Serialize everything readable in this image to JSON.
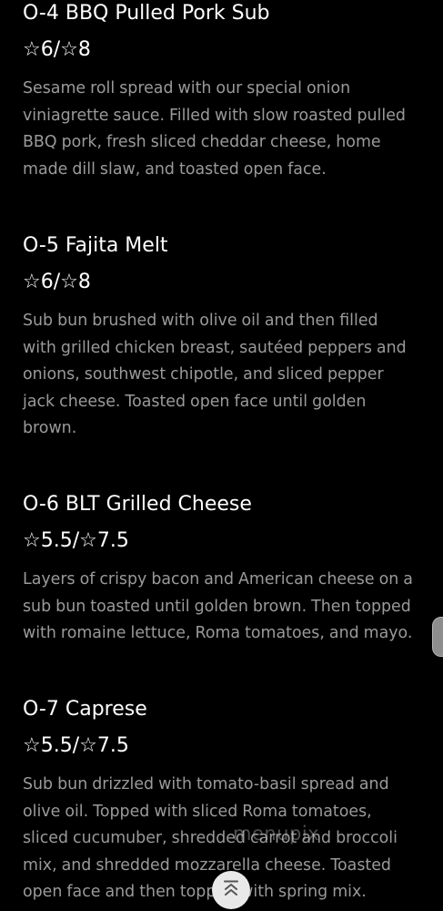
{
  "menu": {
    "items": [
      {
        "title": "O-4 BBQ Pulled Pork Sub",
        "price": "☆6/☆8",
        "description_lines": [
          "Sesame roll spread with our special onion",
          "viniagrette sauce. Filled with slow roasted pulled",
          "BBQ pork, fresh sliced cheddar cheese, home",
          "made dill slaw, and toasted open face."
        ]
      },
      {
        "title": "O-5 Fajita Melt",
        "price": "☆6/☆8",
        "description_lines": [
          "Sub bun brushed with olive oil and then filled",
          "with grilled chicken breast, sautéed peppers and",
          "onions, southwest chipotle, and sliced pepper",
          "jack cheese. Toasted open face until golden",
          "brown."
        ]
      },
      {
        "title": "O-6 BLT Grilled Cheese",
        "price": "☆5.5/☆7.5",
        "description_lines": [
          "Layers of crispy bacon and American cheese on a",
          "sub bun toasted until golden brown. Then topped",
          "with romaine lettuce, Roma tomatoes, and mayo."
        ]
      },
      {
        "title": "O-7 Caprese",
        "price": "☆5.5/☆7.5",
        "description_lines": [
          "Sub bun drizzled with tomato-basil spread and",
          "olive oil. Topped with sliced Roma tomatoes,",
          "sliced cucumuber, shredded carrot and broccoli",
          "mix, and shredded mozzarella cheese. Toasted",
          "open face and then topped with spring mix."
        ]
      }
    ]
  },
  "watermark": "menupix",
  "icons": {
    "scroll_to_top": "chevron-up-double-icon"
  },
  "colors": {
    "background": "#000000",
    "title": "#ffffff",
    "description": "#9a9a9a"
  }
}
